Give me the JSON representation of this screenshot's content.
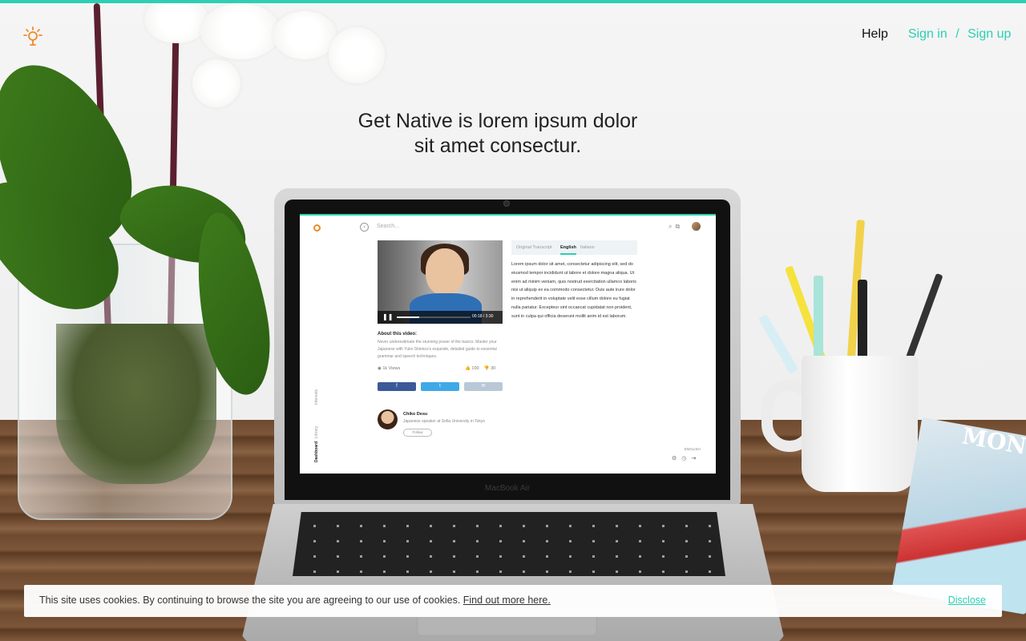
{
  "colors": {
    "accent": "#2ccfb3",
    "logo": "#f08a28",
    "text": "#222222"
  },
  "header": {
    "logo_icon": "lightbulb-icon",
    "nav": {
      "help": "Help",
      "sign_in": "Sign in",
      "separator": "/",
      "sign_up": "Sign up"
    }
  },
  "hero": {
    "headline_line1": "Get Native is lorem ipsum dolor",
    "headline_line2": "sit amet consectur."
  },
  "laptop": {
    "brand_label": "MacBook Air",
    "app": {
      "search_placeholder": "Search...",
      "tabs": [
        "Original Transcript",
        "English",
        "Italiano"
      ],
      "active_tab": "English",
      "transcript": "Lorem ipsum dolor sit amet, consectetur adipiscing elit, sed do eiusmod tempor incididunt ut labore et dolore magna aliqua. Ut enim ad minim veniam, quis nostrud exercitation ullamco laboris nisi ut aliquip ex ea commodo consectetur. Duis aute irure dolor in reprehenderit in voluptate velit esse cillum dolore eu fugiat nulla pariatur. Excepteur sint occaecat cupidatat non proident, sunt in culpa qui officia deserunt mollit anim id est laborum.",
      "video": {
        "time": "00:18 / 3:30",
        "progress": 0.3
      },
      "about_heading": "About this video:",
      "about_text": "Never underestimate the stunning power of the basics. Master your Japanese with Yuko Shimizu's exquisite, detailed guide to essential grammar and speech techniques.",
      "views": "1k Views",
      "likes": "100",
      "dislikes": "30",
      "share_buttons": [
        "f",
        "t",
        "✉"
      ],
      "author": {
        "name": "Chiko Desu",
        "description": "Japanese speaker at Sofia University in Tokyo",
        "follow_label": "Follow"
      },
      "side_nav": [
        "Interests",
        "Library",
        "Dashboard"
      ],
      "language": "ENGLISH"
    }
  },
  "cookie_bar": {
    "text": "This site uses cookies. By continuing to browse the site you are agreeing to our use of cookies. ",
    "link": "Find out more here.",
    "disclose": "Disclose"
  }
}
